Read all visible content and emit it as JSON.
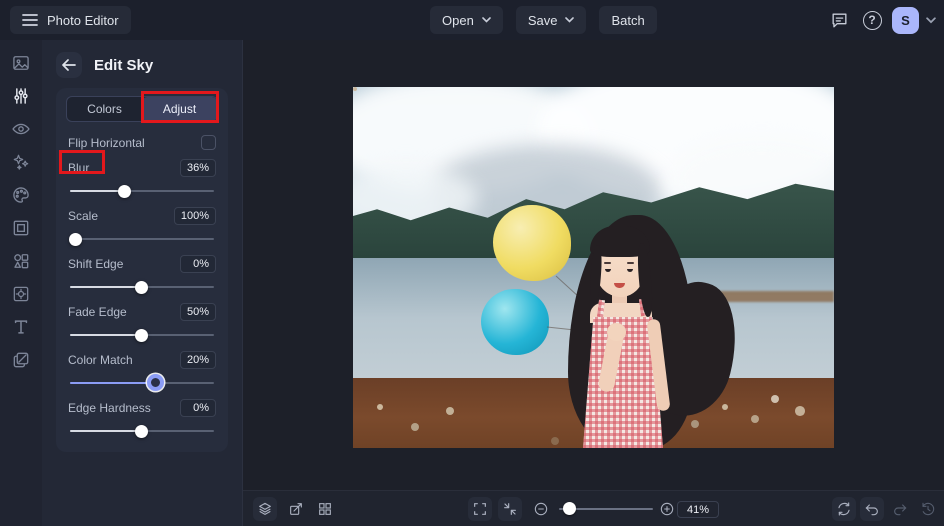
{
  "topbar": {
    "app_title": "Photo Editor",
    "open_label": "Open",
    "save_label": "Save",
    "batch_label": "Batch",
    "avatar_initial": "S"
  },
  "icons": {
    "help_glyph": "?",
    "rail": [
      "image-icon",
      "adjust-sliders-icon",
      "eye-icon",
      "effects-sparkles-icon",
      "palette-icon",
      "frame-icon",
      "shapes-icon",
      "overlay-icon",
      "text-icon",
      "layers-copy-icon"
    ],
    "rail_active": "adjust-sliders-icon",
    "topbar_right": [
      "comments-icon",
      "help-icon",
      "avatar",
      "chevron-down-icon"
    ],
    "bottombar_left": [
      "layers-icon",
      "transform-icon",
      "grid-icon"
    ],
    "bottombar_center": [
      "fullscreen-icon",
      "fit-screen-icon",
      "zoom-out-icon",
      "zoom-slider",
      "zoom-in-icon"
    ],
    "bottombar_right": [
      "refresh-icon",
      "undo-icon",
      "redo-icon",
      "history-icon"
    ]
  },
  "panel": {
    "title": "Edit Sky",
    "tabs": {
      "colors": "Colors",
      "adjust": "Adjust",
      "active_tab": "Adjust"
    },
    "flip_horizontal": {
      "label": "Flip Horizontal",
      "checked": false
    },
    "sliders": [
      {
        "label": "Blur",
        "value": "36%"
      },
      {
        "label": "Scale",
        "value": "100%"
      },
      {
        "label": "Shift Edge",
        "value": "0%"
      },
      {
        "label": "Fade Edge",
        "value": "50%"
      },
      {
        "label": "Color Match",
        "value": "20%",
        "active": true
      },
      {
        "label": "Edge Hardness",
        "value": "0%"
      }
    ],
    "annotations": [
      "red box around Adjust tab",
      "red box around Blur label"
    ]
  },
  "bottombar": {
    "zoom_level": "41%"
  },
  "colors": {
    "accent_periwinkle": "#8b9cf5",
    "annotation_red": "#e3181c",
    "avatar_bg": "#aab6fb",
    "balloon_yellow": "#f0dc62",
    "balloon_teal": "#25b5d6"
  }
}
